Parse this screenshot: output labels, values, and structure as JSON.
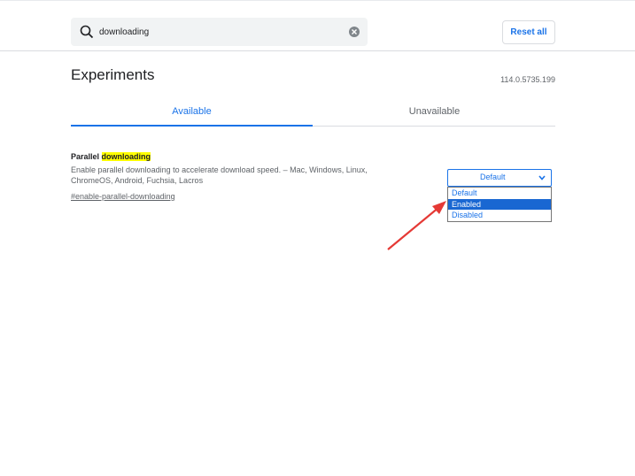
{
  "search": {
    "value": "downloading"
  },
  "header": {
    "reset_label": "Reset all"
  },
  "page": {
    "title": "Experiments",
    "version": "114.0.5735.199"
  },
  "tabs": [
    {
      "label": "Available",
      "active": true
    },
    {
      "label": "Unavailable",
      "active": false
    }
  ],
  "experiment": {
    "title_prefix": "Parallel ",
    "title_highlight": "downloading",
    "description_line1": "Enable parallel downloading to accelerate download speed. – Mac, Windows, Linux,",
    "description_line2": "ChromeOS, Android, Fuchsia, Lacros",
    "link": "#enable-parallel-downloading",
    "select_value": "Default",
    "options": [
      "Default",
      "Enabled",
      "Disabled"
    ],
    "highlighted_option": "Enabled"
  },
  "colors": {
    "accent": "#1a73e8",
    "highlight": "#ffff00",
    "arrow": "#e53935"
  }
}
